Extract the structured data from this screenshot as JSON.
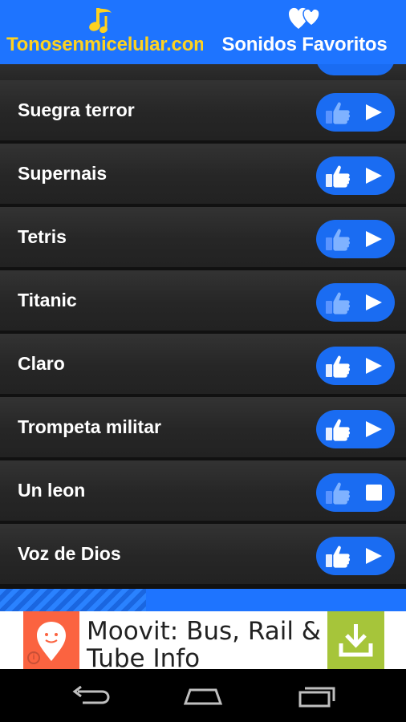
{
  "tabs": {
    "left_label": "Tonosenmicelular.com",
    "right_label": "Sonidos Favoritos"
  },
  "list": {
    "items": [
      {
        "name": "Suegra terror",
        "state": "play",
        "liked": false
      },
      {
        "name": "Supernais",
        "state": "play",
        "liked": true
      },
      {
        "name": "Tetris",
        "state": "play",
        "liked": false
      },
      {
        "name": "Titanic",
        "state": "play",
        "liked": false
      },
      {
        "name": "Claro",
        "state": "play",
        "liked": true
      },
      {
        "name": "Trompeta militar",
        "state": "play",
        "liked": true
      },
      {
        "name": "Un leon",
        "state": "stop",
        "liked": false
      },
      {
        "name": "Voz de Dios",
        "state": "play",
        "liked": true
      }
    ]
  },
  "playback": {
    "loaded_fraction": 0.36
  },
  "ad": {
    "text_line1": "Moovit: Bus, Rail &",
    "text_line2": "Tube Info",
    "info_label": "i"
  },
  "colors": {
    "accent": "#1e74ff",
    "tab_left_label": "#ffd21f",
    "pill": "#1a6cf2",
    "ad_logo": "#fb6340",
    "ad_download": "#a6c53a"
  }
}
